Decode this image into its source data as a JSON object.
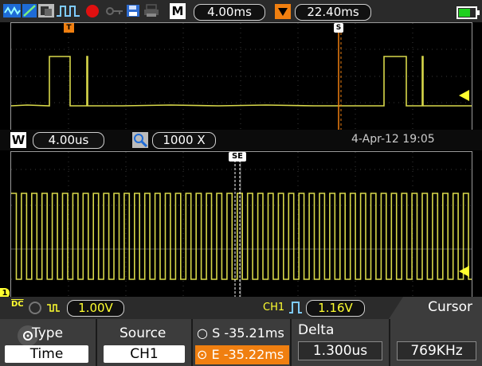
{
  "toolbar": {
    "horizontal_label": "M",
    "timebase": "4.00ms",
    "trigger_label": "T",
    "trigger_position": "22.40ms"
  },
  "upper_window": {
    "trigger_marker": "T",
    "cursor_marker": "S"
  },
  "zoom_bar": {
    "window_label": "W",
    "window_timebase": "4.00us",
    "zoom_factor": "1000 X",
    "datetime": "4-Apr-12 19:05"
  },
  "lower_window": {
    "cursor_marker": "SE",
    "ch_marker": "1"
  },
  "status_bar": {
    "coupling": "DC",
    "ch1_scale": "1.00V",
    "trigger_source": "CH1",
    "trigger_level": "1.16V",
    "menu_title": "Cursor"
  },
  "softkeys": {
    "type_label": "Type",
    "type_value": "Time",
    "source_label": "Source",
    "source_value": "CH1",
    "s_prefix": "S",
    "s_value": "-35.21ms",
    "e_prefix": "E",
    "e_value": "-35.22ms",
    "delta_label": "Delta",
    "delta_value": "1.300us",
    "freq_value": "769KHz"
  },
  "colors": {
    "trace": "#d8d84a",
    "accent": "#f07f10",
    "record": "#e01010",
    "battery": "#20d020"
  }
}
